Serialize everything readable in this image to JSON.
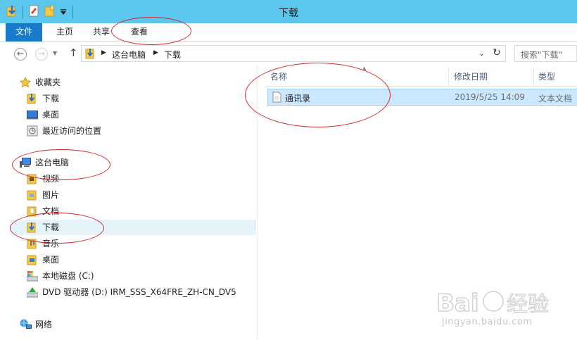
{
  "window": {
    "title": "下载"
  },
  "ribbon": {
    "tabs": [
      "文件",
      "主页",
      "共享",
      "查看"
    ]
  },
  "address": {
    "crumbs": [
      "这台电脑",
      "下载"
    ],
    "search_placeholder": "搜索\"下载\""
  },
  "nav": {
    "favorites_label": "收藏夹",
    "favorites": [
      "下载",
      "桌面",
      "最近访问的位置"
    ],
    "pc_label": "这台电脑",
    "pc_items": [
      "视频",
      "图片",
      "文档",
      "下载",
      "音乐",
      "桌面",
      "本地磁盘 (C:)",
      "DVD 驱动器 (D:) IRM_SSS_X64FRE_ZH-CN_DV5"
    ],
    "network_label": "网络"
  },
  "columns": [
    "名称",
    "修改日期",
    "类型"
  ],
  "files": [
    {
      "name": "通讯录",
      "date": "2019/5/25 14:09",
      "type": "文本文档"
    }
  ],
  "watermark": {
    "brand": "Baidu经验",
    "url": "jingyan.baidu.com"
  },
  "colors": {
    "titlebar": "#5bc7ef",
    "file_tab": "#1979ca",
    "selection": "#cce8ff",
    "annotation": "#d3272c"
  }
}
